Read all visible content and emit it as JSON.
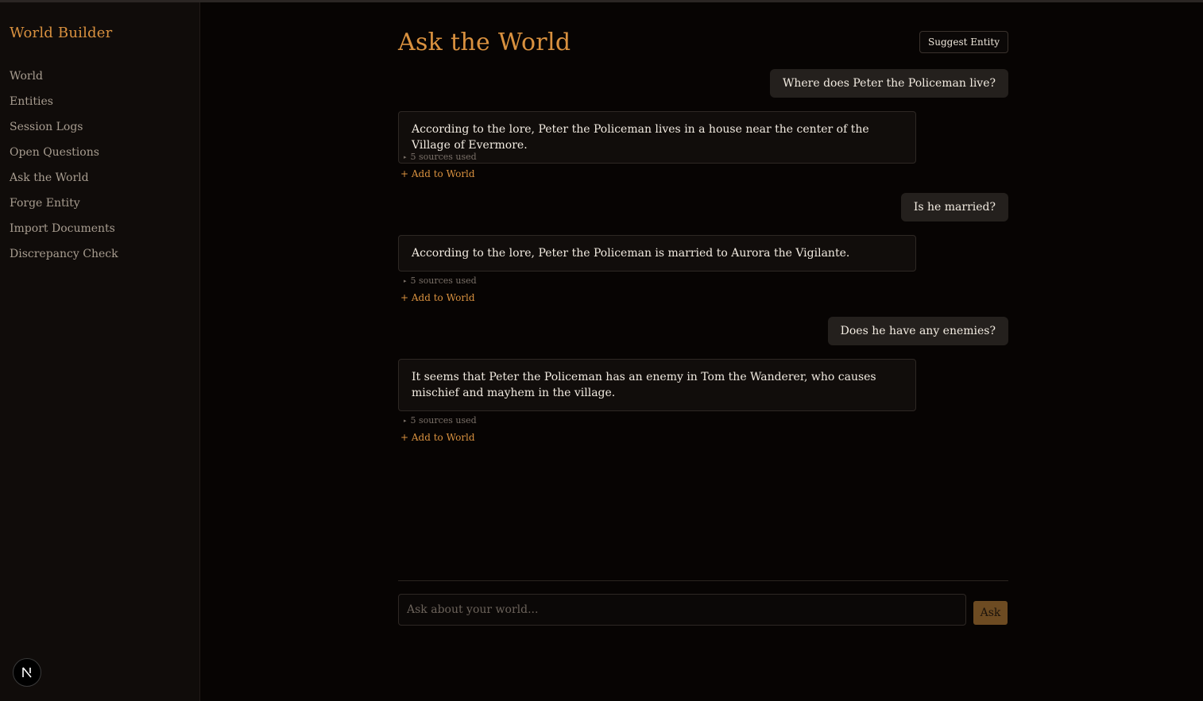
{
  "app": {
    "title": "World Builder"
  },
  "sidebar": {
    "items": [
      {
        "label": "World"
      },
      {
        "label": "Entities"
      },
      {
        "label": "Session Logs"
      },
      {
        "label": "Open Questions"
      },
      {
        "label": "Ask the World"
      },
      {
        "label": "Forge Entity"
      },
      {
        "label": "Import Documents"
      },
      {
        "label": "Discrepancy Check"
      }
    ],
    "badge_letter": "N"
  },
  "header": {
    "title": "Ask the World",
    "suggest_label": "Suggest Entity"
  },
  "chat": {
    "messages": [
      {
        "question": "Where does Peter the Policeman live?",
        "answer": "According to the lore, Peter the Policeman lives in a house near the center of the Village of Evermore.",
        "sources": "5 sources used",
        "add_label": "+ Add to World"
      },
      {
        "question": "Is he married?",
        "answer": "According to the lore, Peter the Policeman is married to Aurora the Vigilante.",
        "sources": "5 sources used",
        "add_label": "+ Add to World"
      },
      {
        "question": "Does he have any enemies?",
        "answer": "It seems that Peter the Policeman has an enemy in Tom the Wanderer, who causes mischief and mayhem in the village.",
        "sources": "5 sources used",
        "add_label": "+ Add to World"
      }
    ]
  },
  "composer": {
    "placeholder": "Ask about your world...",
    "ask_label": "Ask"
  },
  "colors": {
    "accent": "#d9913f",
    "background": "#070403",
    "sidebar": "#100c0a",
    "user_bubble": "#24201d",
    "ask_button": "#6d4b22"
  }
}
